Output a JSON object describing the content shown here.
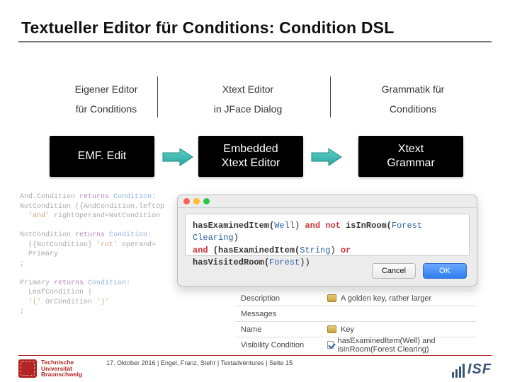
{
  "title": "Textueller Editor für Conditions: Condition DSL",
  "columns": {
    "c1_line1": "Eigener Editor",
    "c1_line2": "für Conditions",
    "c2_line1": "Xtext Editor",
    "c2_line2": "in JFace Dialog",
    "c3_line1": "Grammatik für",
    "c3_line2": "Conditions"
  },
  "boxes": {
    "b1": "EMF. Edit",
    "b2_l1": "Embedded",
    "b2_l2": "Xtext Editor",
    "b3_l1": "Xtext",
    "b3_l2": "Grammar"
  },
  "code": {
    "l1a": "And.Condition ",
    "l1b": "returns ",
    "l1c": "Condition",
    "l1d": ":",
    "l2a": "NotCondition ({AndCondition.leftOp",
    "l3a": "'and' ",
    "l3b": "rightOperand=NotCondition",
    "l4": "",
    "l5a": "NotCondition ",
    "l5b": "returns ",
    "l5c": "Condition",
    "l5d": ":",
    "l6a": "({NotCondition} ",
    "l6b": "'rot' ",
    "l6c": "operand=",
    "l7": "Primary",
    "l8": ";",
    "l9": "",
    "l10a": "Primary ",
    "l10b": "returns ",
    "l10c": "Condition",
    "l10d": ":",
    "l11": "LeafCondition |",
    "l12a": "'(' ",
    "l12b": "OrCondition ",
    "l12c": "')'",
    "l13": ";"
  },
  "dialog": {
    "line1_pre": "hasExaminedItem(",
    "line1_arg1": "Well",
    "line1_mid1": ") ",
    "line1_and": "and not",
    "line1_mid2": " isInRoom(",
    "line1_arg2": "Forest Clearing",
    "line1_post": ")",
    "line2_and1": "and",
    "line2_pre": " (hasExaminedItem(",
    "line2_arg1": "String",
    "line2_mid1": ") ",
    "line2_or": "or",
    "line2_mid2": " hasVisitedRoom(",
    "line2_arg2": "Forest",
    "line2_post": "))",
    "btn_cancel": "Cancel",
    "btn_ok": "OK"
  },
  "props": {
    "r1k": "Description",
    "r1v": "A golden key, rather larger",
    "r2k": "Messages",
    "r2v": "",
    "r3k": "Name",
    "r3v": "Key",
    "r4k": "Visibility Condition",
    "r4v": "hasExaminedItem(Well) and isInRoom(Forest Clearing)"
  },
  "footer": {
    "uni_l1": "Technische",
    "uni_l2": "Universität",
    "uni_l3": "Braunschweig",
    "meta": "17. Oktober 2016 | Engel, Franz, Stehr | Textadventures | Seite 15",
    "isf": "ISF"
  }
}
